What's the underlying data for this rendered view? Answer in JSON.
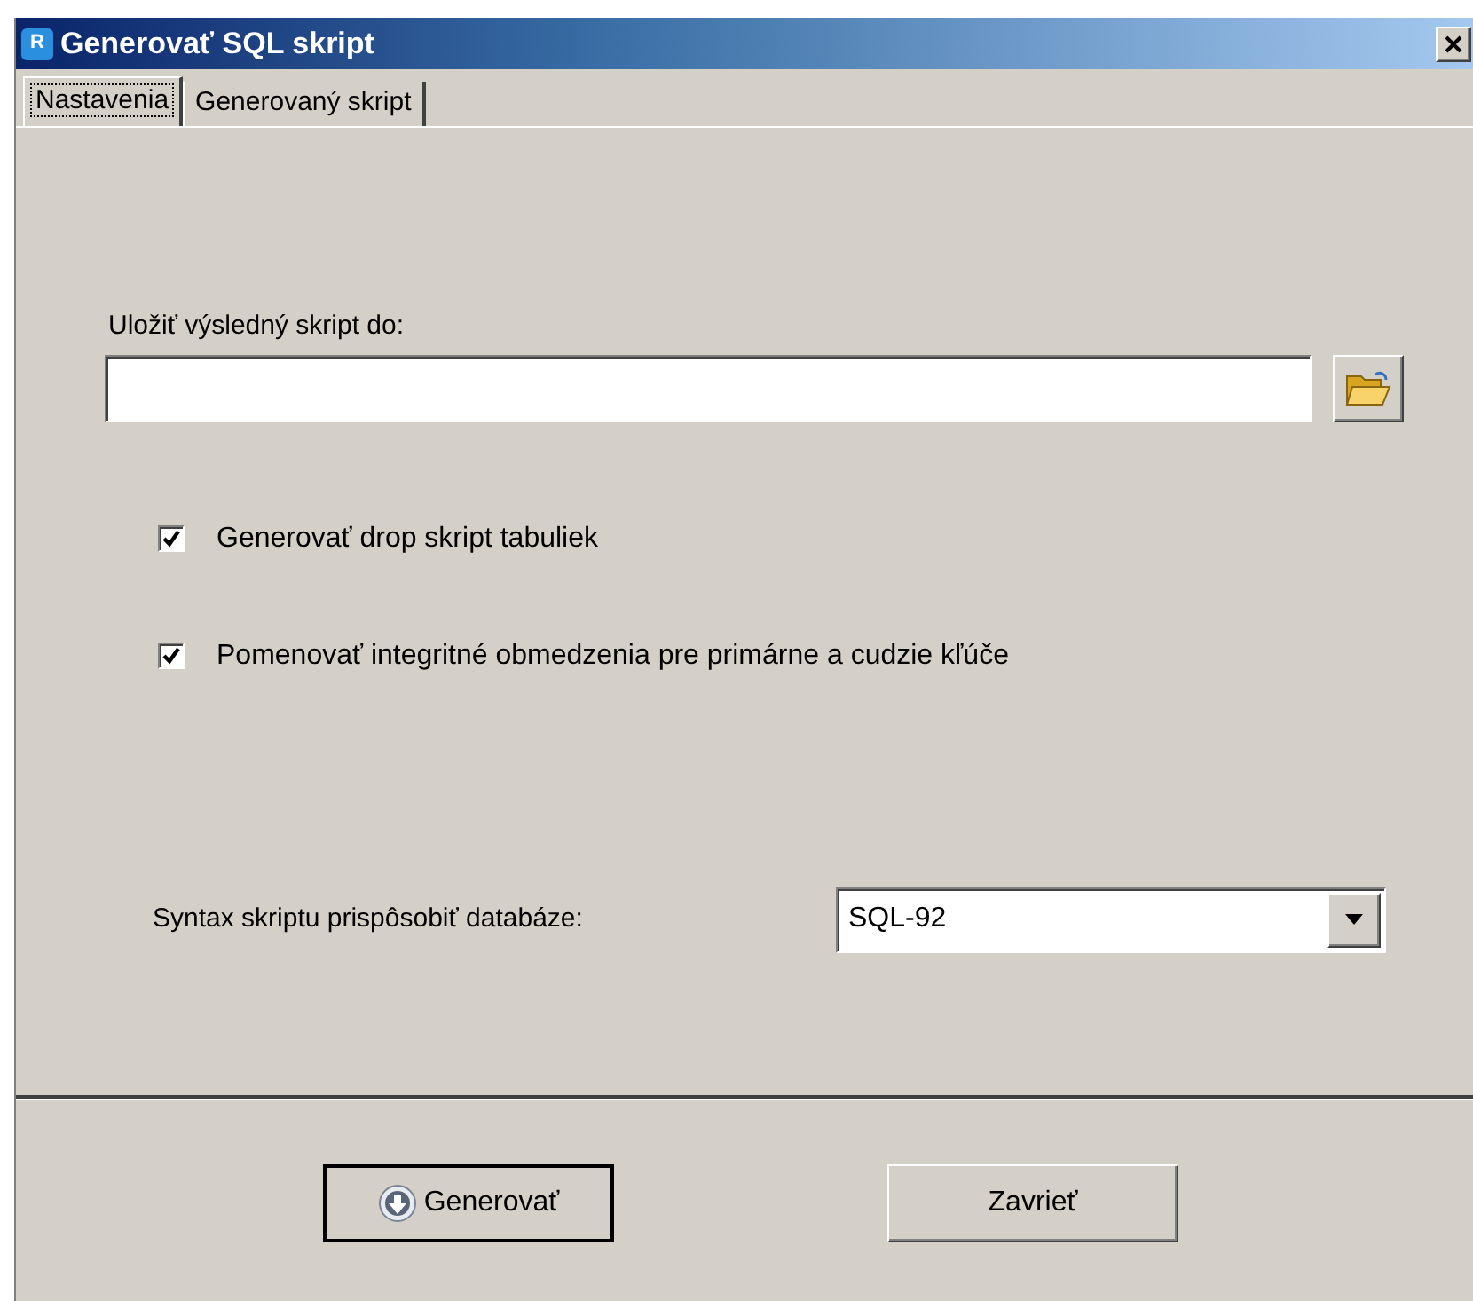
{
  "window": {
    "title": "Generovať SQL skript",
    "app_icon_letter": "R"
  },
  "tabs": [
    {
      "label": "Nastavenia",
      "selected": true
    },
    {
      "label": "Generovaný skript",
      "selected": false
    }
  ],
  "output": {
    "label": "Uložiť výsledný skript do:"
  },
  "options": [
    {
      "label": "Generovať drop skript tabuliek",
      "checked": true
    },
    {
      "label": "Pomenovať integritné obmedzenia pre primárne a cudzie kľúče",
      "checked": true
    }
  ],
  "dialect": {
    "label": "Syntax skriptu prispôsobiť databáze:",
    "value": "SQL-92"
  },
  "buttons": [
    {
      "label": "Generovať",
      "kind": "generate"
    },
    {
      "label": "Zavrieť",
      "kind": "close"
    }
  ]
}
